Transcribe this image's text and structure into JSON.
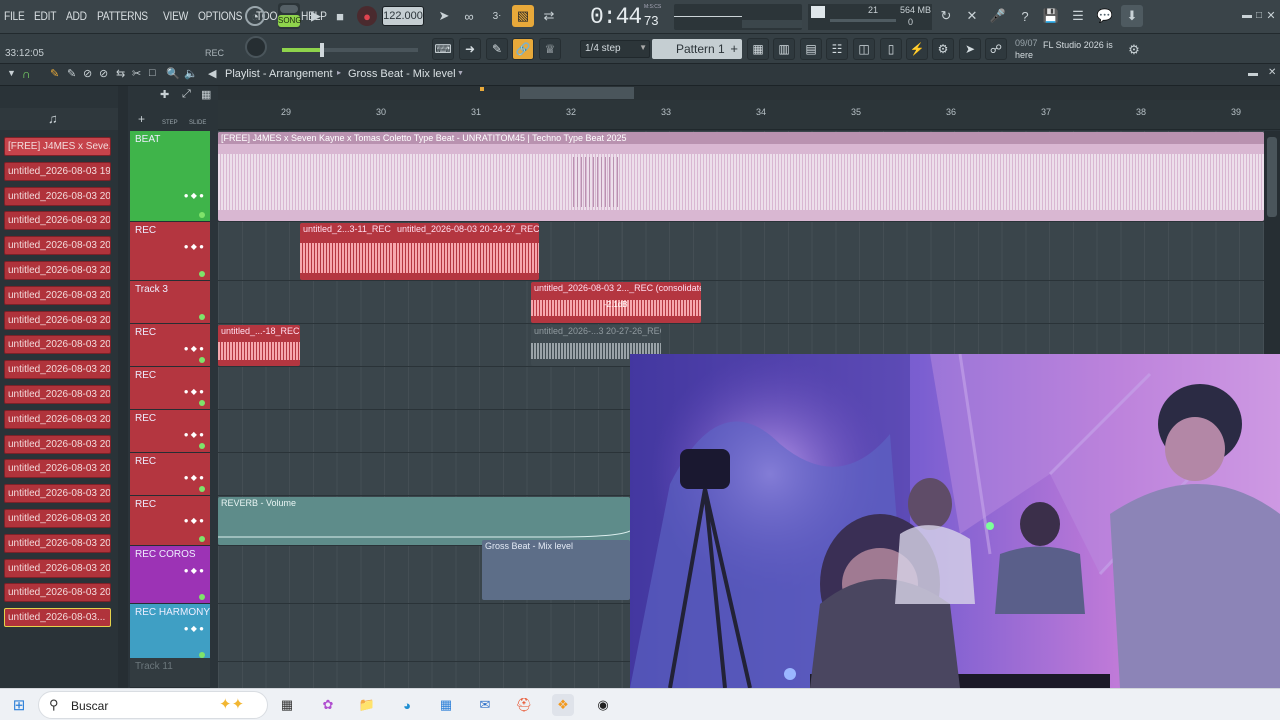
{
  "menu": {
    "items": [
      "FILE",
      "EDIT",
      "ADD",
      "PATTERNS",
      "VIEW",
      "OPTIONS",
      "TOOLS",
      "HELP"
    ]
  },
  "transport": {
    "mode": "SONG",
    "tempo": "122.000",
    "time": "0:44",
    "time_sub": "73",
    "time_unit": "M:S:CS",
    "counter": "21",
    "memory": "564 MB",
    "memory_sub": "0"
  },
  "status": {
    "elapsed": "33:12:05",
    "rec": "REC"
  },
  "snap": {
    "step": "1/4 step"
  },
  "pattern": {
    "name": "Pattern 1"
  },
  "news": {
    "date": "09/07",
    "text": "FL Studio 2026 is here"
  },
  "playlist": {
    "breadcrumb": "Playlist - Arrangement",
    "target": "Gross Beat - Mix level",
    "step_label": "STEP",
    "slide_label": "SLIDE"
  },
  "ruler": {
    "bars": [
      "29",
      "30",
      "31",
      "32",
      "33",
      "34",
      "35",
      "36",
      "37",
      "38",
      "39"
    ]
  },
  "patterns": [
    "[FREE] J4MES x Seve...",
    "untitled_2026-08-03 19-...",
    "untitled_2026-08-03 20-...",
    "untitled_2026-08-03 20-...",
    "untitled_2026-08-03 20-...",
    "untitled_2026-08-03 20-...",
    "untitled_2026-08-03 20-...",
    "untitled_2026-08-03 20-...",
    "untitled_2026-08-03 20-...",
    "untitled_2026-08-03 20-...",
    "untitled_2026-08-03 20-...",
    "untitled_2026-08-03 20-...",
    "untitled_2026-08-03 20-...",
    "untitled_2026-08-03 20-...",
    "untitled_2026-08-03 20-...",
    "untitled_2026-08-03 20-...",
    "untitled_2026-08-03 20-...",
    "untitled_2026-08-03 20-...",
    "untitled_2026-08-03 20-...",
    "untitled_2026-08-03..."
  ],
  "tracks": [
    {
      "name": "BEAT",
      "color": "#3fb44a"
    },
    {
      "name": "REC",
      "color": "#b43640"
    },
    {
      "name": "Track 3",
      "color": "#b43640"
    },
    {
      "name": "REC",
      "color": "#b43640"
    },
    {
      "name": "REC",
      "color": "#b43640"
    },
    {
      "name": "REC",
      "color": "#b43640"
    },
    {
      "name": "REC",
      "color": "#b43640"
    },
    {
      "name": "REC",
      "color": "#b43640"
    },
    {
      "name": "REC COROS",
      "color": "#9c33b5"
    },
    {
      "name": "REC HARMONY",
      "color": "#3f9fc4"
    },
    {
      "name": "Track 11",
      "color": "#323b40"
    }
  ],
  "clips": {
    "beat": "[FREE] J4MES x Seven Kayne x Tomas Coletto Type Beat - UNRATITOM45 | Techno Type Beat 2025",
    "rec1": "untitled_2...3-11_REC",
    "rec2": "untitled_2026-08-03 20-24-27_REC",
    "cons": "untitled_2026-08-03 2..._REC (consolidated)",
    "cons_gain": "-2.1dB",
    "small1": "untitled_...-18_REC",
    "small2": "untitled_2026-...3 20-27-26_REC",
    "reverb": "REVERB - Volume",
    "gross": "Gross Beat - Mix level"
  },
  "taskbar": {
    "search_placeholder": "Buscar"
  },
  "colors": {
    "accent": "#e8a93a",
    "rec": "#b43640",
    "beat_clip": "#d9b7d2",
    "green": "#3fb44a"
  }
}
